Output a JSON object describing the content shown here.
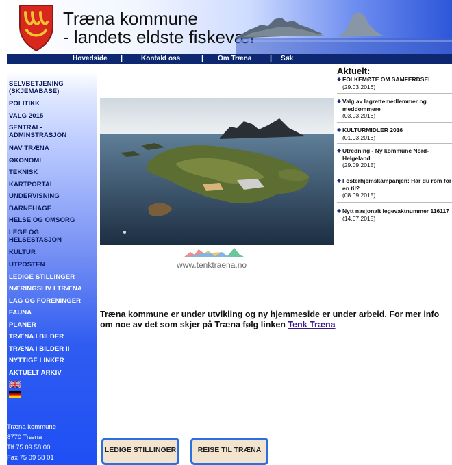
{
  "header": {
    "title": "Træna kommune",
    "subtitle": "- landets eldste fiskevær",
    "brand_blue": "#2d56d9"
  },
  "nav": {
    "items": [
      "Hovedside",
      "Kontakt oss",
      "Om Træna",
      "Søk"
    ],
    "separator": "|"
  },
  "sidebar": {
    "items": [
      "SELVBETJENING (SKJEMABASE)",
      "POLITIKK",
      "VALG 2015",
      "SENTRAL-ADMINSTRASJON",
      "NAV TRÆNA",
      "ØKONOMI",
      "TEKNISK",
      "KARTPORTAL",
      "UNDERVISNING",
      "BARNEHAGE",
      "HELSE OG OMSORG",
      "LEGE OG HELSESTASJON",
      "KULTUR",
      "UTPOSTEN",
      "LEDIGE STILLINGER",
      "NÆRINGSLIV I TRÆNA",
      "LAG OG FORENINGER",
      "FAUNA",
      "PLANER",
      "TRÆNA I BILDER",
      "TRÆNA I BILDER II",
      "NYTTIGE LINKER",
      "AKTUELT ARKIV"
    ],
    "flags": [
      "uk-flag-icon",
      "german-flag-icon"
    ],
    "address": {
      "name": "Træna kommune",
      "postal": "8770 Træna",
      "phone": "Tlf  75 09 58 00",
      "fax": "Fax 75 09 58 01"
    }
  },
  "main": {
    "logo_text": "www.tenktraena.no",
    "intro_text": "Træna kommune er under utvikling og ny hjemmeside er under arbeid. For mer info om noe av det som skjer på Træna følg linken ",
    "intro_link": "Tenk Træna"
  },
  "news": {
    "heading": "Aktuelt:",
    "items": [
      {
        "title": "FOLKEMØTE OM SAMFERDSEL",
        "date": "(29.03.2016)"
      },
      {
        "title": "Valg av lagrettemedlemmer og meddommere",
        "date": "(03.03.2016)"
      },
      {
        "title": "KULTURMIDLER 2016",
        "date": "(01.03.2016)"
      },
      {
        "title": "Utredning - Ny kommune Nord-Helgeland",
        "date": "(29.09.2015)"
      },
      {
        "title": "Fosterhjemskampanjen: Har du rom for en til?",
        "date": "(08.09.2015)"
      },
      {
        "title": "Nytt nasjonalt legevaktnummer 116117",
        "date": "(14.07.2015)"
      }
    ]
  },
  "buttons": {
    "jobs": "LEDIGE STILLINGER",
    "travel": "REISE TIL TRÆNA"
  }
}
